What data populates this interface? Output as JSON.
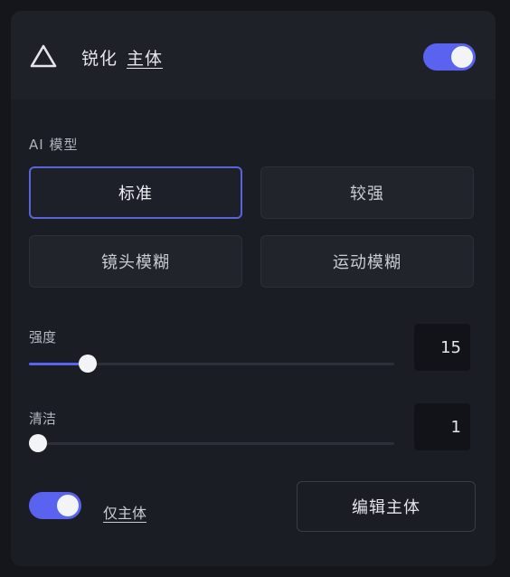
{
  "header": {
    "title_prefix": "锐化",
    "title_link": "主体",
    "enabled": true
  },
  "model_section": {
    "label": "AI 模型",
    "options": [
      {
        "label": "标准",
        "selected": true
      },
      {
        "label": "较强",
        "selected": false
      },
      {
        "label": "镜头模糊",
        "selected": false
      },
      {
        "label": "运动模糊",
        "selected": false
      }
    ]
  },
  "sliders": [
    {
      "label": "强度",
      "value": "15",
      "fraction": 0.16
    },
    {
      "label": "清洁",
      "value": "1",
      "fraction": 0.02
    }
  ],
  "footer": {
    "subject_only_label": "仅主体",
    "subject_only_enabled": true,
    "edit_subject_label": "编辑主体"
  },
  "colors": {
    "accent": "#5a63f0",
    "panel": "#1b1d24",
    "background": "#15161b"
  },
  "icons": {
    "header": "triangle-icon"
  }
}
